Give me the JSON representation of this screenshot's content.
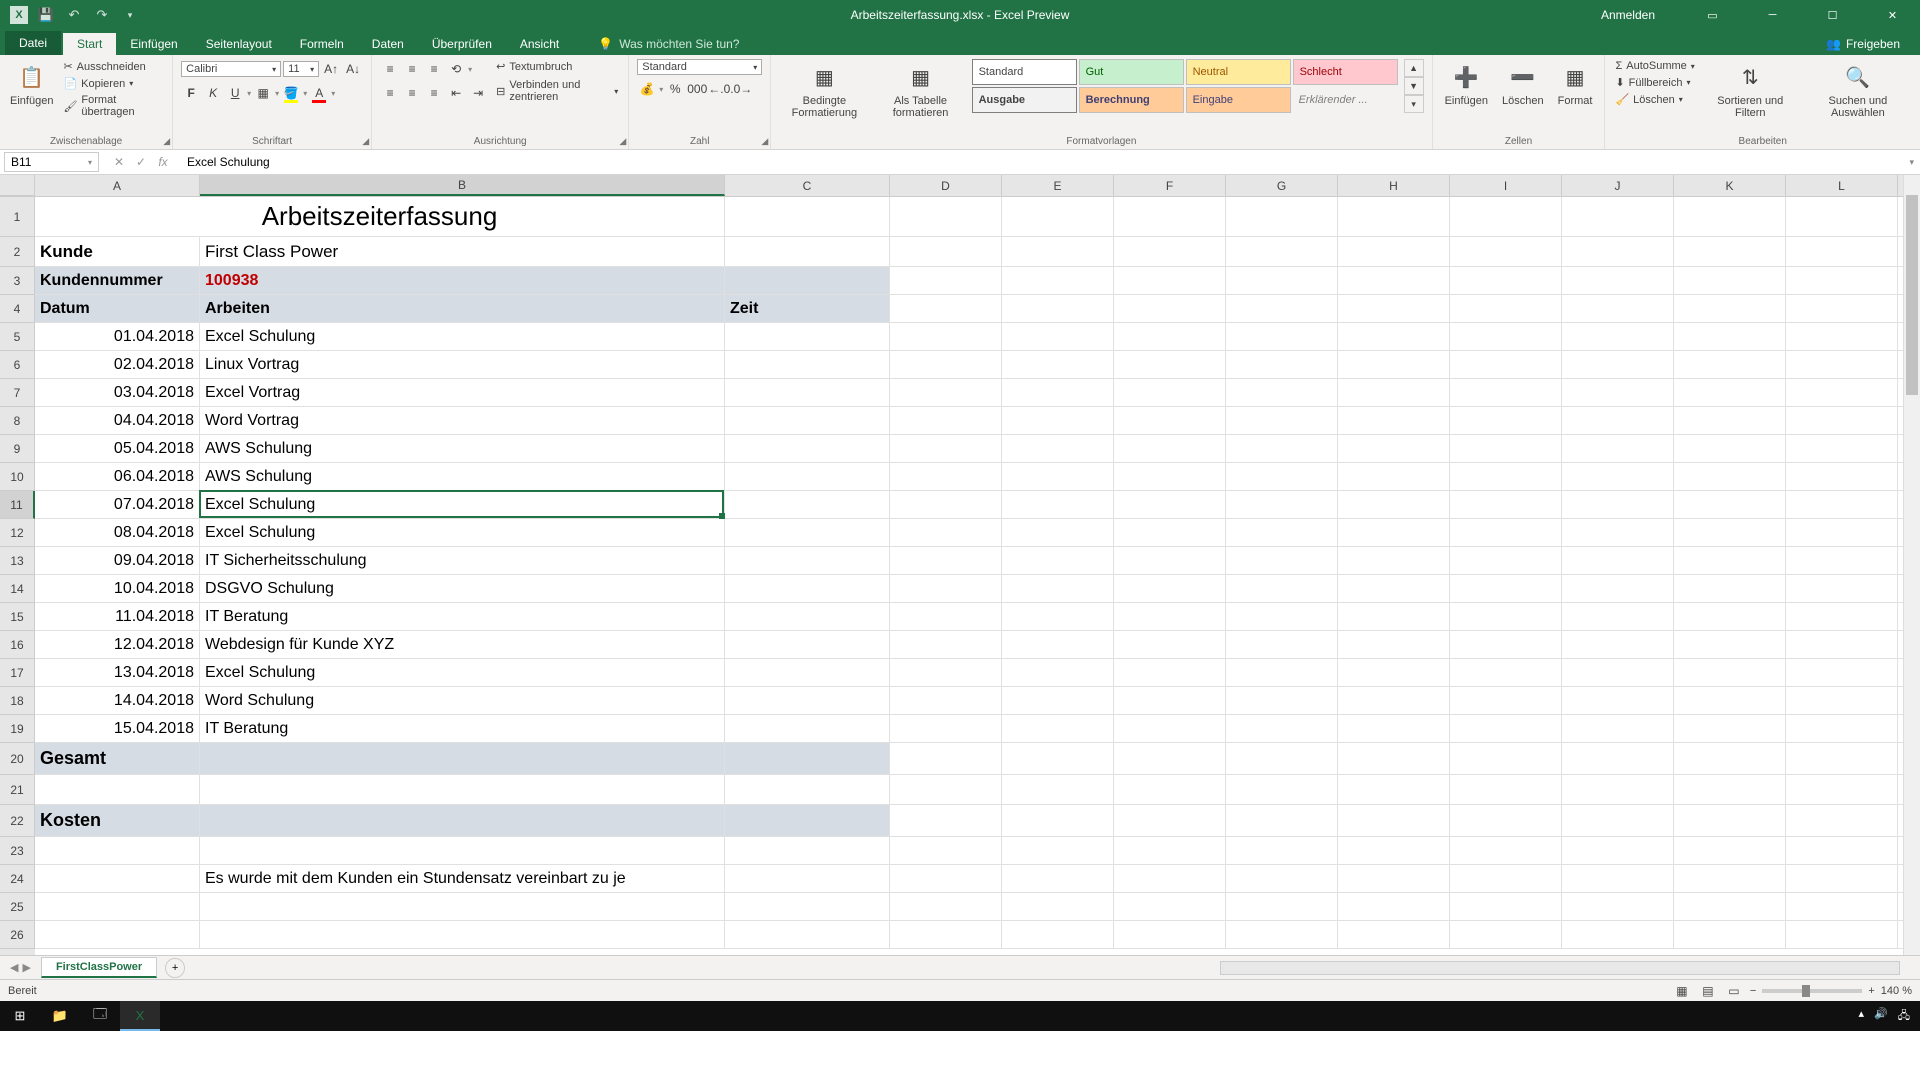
{
  "titlebar": {
    "title": "Arbeitszeiterfassung.xlsx - Excel Preview",
    "signin": "Anmelden"
  },
  "tabs": {
    "datei": "Datei",
    "start": "Start",
    "einfuegen": "Einfügen",
    "seitenlayout": "Seitenlayout",
    "formeln": "Formeln",
    "daten": "Daten",
    "ueberpruefen": "Überprüfen",
    "ansicht": "Ansicht",
    "tellme": "Was möchten Sie tun?",
    "share": "Freigeben"
  },
  "ribbon": {
    "clipboard": {
      "paste": "Einfügen",
      "cut": "Ausschneiden",
      "copy": "Kopieren",
      "formatpainter": "Format übertragen",
      "label": "Zwischenablage"
    },
    "font": {
      "name": "Calibri",
      "size": "11",
      "label": "Schriftart"
    },
    "alignment": {
      "wrap": "Textumbruch",
      "merge": "Verbinden und zentrieren",
      "label": "Ausrichtung"
    },
    "number": {
      "format": "Standard",
      "label": "Zahl"
    },
    "styles": {
      "cond": "Bedingte Formatierung",
      "table": "Als Tabelle formatieren",
      "standard": "Standard",
      "gut": "Gut",
      "neutral": "Neutral",
      "schlecht": "Schlecht",
      "ausgabe": "Ausgabe",
      "berechnung": "Berechnung",
      "eingabe": "Eingabe",
      "erkl": "Erklärender ...",
      "label": "Formatvorlagen"
    },
    "cells": {
      "insert": "Einfügen",
      "delete": "Löschen",
      "format": "Format",
      "label": "Zellen"
    },
    "editing": {
      "autosum": "AutoSumme",
      "fill": "Füllbereich",
      "clear": "Löschen",
      "sort": "Sortieren und Filtern",
      "find": "Suchen und Auswählen",
      "label": "Bearbeiten"
    }
  },
  "formula": {
    "namebox": "B11",
    "content": "Excel Schulung"
  },
  "columns": [
    "A",
    "B",
    "C",
    "D",
    "E",
    "F",
    "G",
    "H",
    "I",
    "J",
    "K",
    "L"
  ],
  "sheet": {
    "title": "Arbeitszeiterfassung",
    "kunde_label": "Kunde",
    "kunde_value": "First Class Power",
    "kundennr_label": "Kundennummer",
    "kundennr_value": "100938",
    "h_datum": "Datum",
    "h_arbeiten": "Arbeiten",
    "h_zeit": "Zeit",
    "rows": [
      {
        "datum": "01.04.2018",
        "arbeit": "Excel Schulung"
      },
      {
        "datum": "02.04.2018",
        "arbeit": "Linux Vortrag"
      },
      {
        "datum": "03.04.2018",
        "arbeit": "Excel Vortrag"
      },
      {
        "datum": "04.04.2018",
        "arbeit": "Word Vortrag"
      },
      {
        "datum": "05.04.2018",
        "arbeit": "AWS Schulung"
      },
      {
        "datum": "06.04.2018",
        "arbeit": "AWS Schulung"
      },
      {
        "datum": "07.04.2018",
        "arbeit": "Excel Schulung"
      },
      {
        "datum": "08.04.2018",
        "arbeit": "Excel Schulung"
      },
      {
        "datum": "09.04.2018",
        "arbeit": "IT Sicherheitsschulung"
      },
      {
        "datum": "10.04.2018",
        "arbeit": "DSGVO Schulung"
      },
      {
        "datum": "11.04.2018",
        "arbeit": "IT Beratung"
      },
      {
        "datum": "12.04.2018",
        "arbeit": "Webdesign für Kunde XYZ"
      },
      {
        "datum": "13.04.2018",
        "arbeit": "Excel Schulung"
      },
      {
        "datum": "14.04.2018",
        "arbeit": "Word Schulung"
      },
      {
        "datum": "15.04.2018",
        "arbeit": "IT Beratung"
      }
    ],
    "gesamt": "Gesamt",
    "kosten": "Kosten",
    "note": "Es wurde mit dem Kunden ein Stundensatz vereinbart zu je"
  },
  "sheettab": "FirstClassPower",
  "status": {
    "ready": "Bereit",
    "zoom": "140 %"
  }
}
